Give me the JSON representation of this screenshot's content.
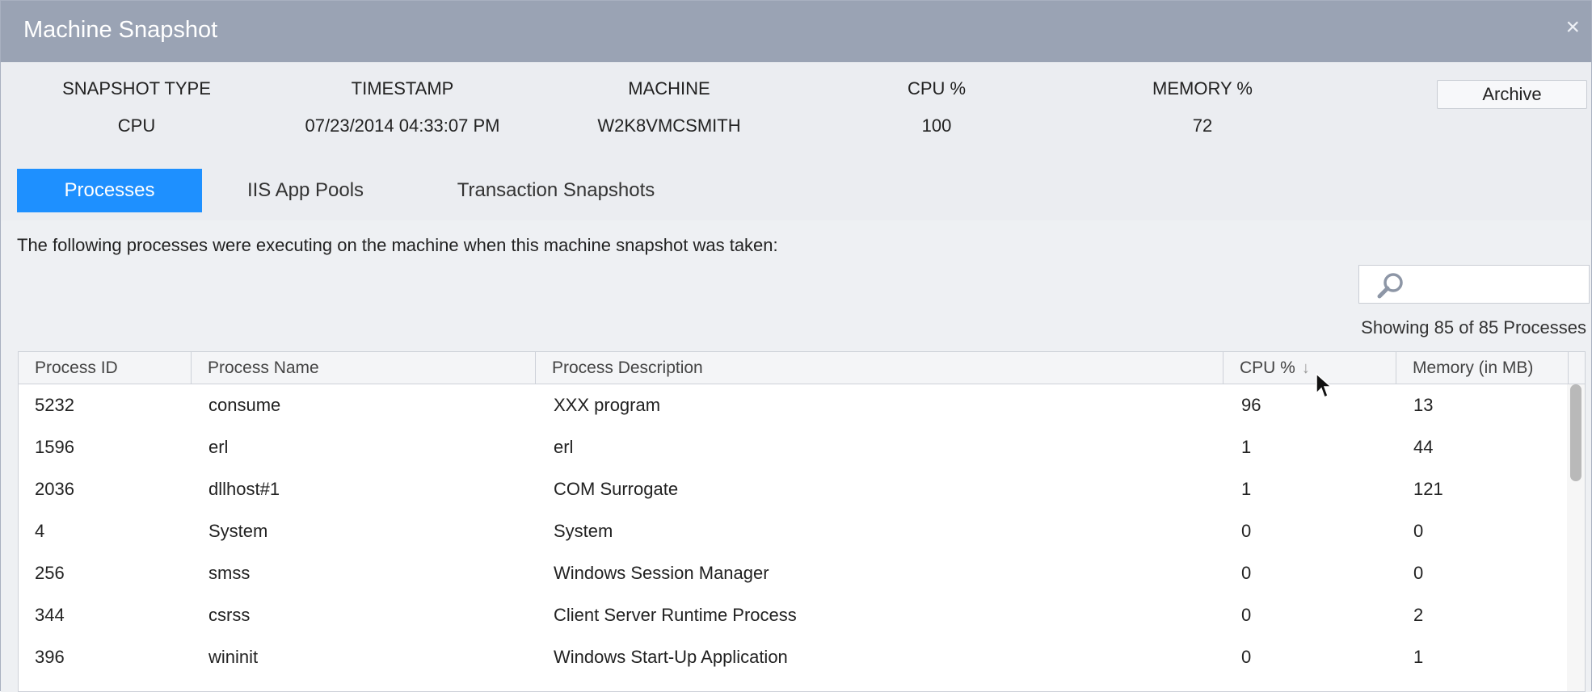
{
  "window": {
    "title": "Machine Snapshot",
    "close_label": "×"
  },
  "summary": {
    "columns": [
      {
        "header": "SNAPSHOT TYPE",
        "value": "CPU"
      },
      {
        "header": "TIMESTAMP",
        "value": "07/23/2014 04:33:07 PM"
      },
      {
        "header": "MACHINE",
        "value": "W2K8VMCSMITH"
      },
      {
        "header": "CPU %",
        "value": "100"
      },
      {
        "header": "MEMORY %",
        "value": "72"
      }
    ],
    "archive_label": "Archive"
  },
  "tabs": [
    {
      "label": "Processes",
      "active": true
    },
    {
      "label": "IIS App Pools",
      "active": false
    },
    {
      "label": "Transaction Snapshots",
      "active": false
    }
  ],
  "content": {
    "description": "The following processes were executing on the machine when this machine snapshot was taken:",
    "search": {
      "placeholder": "",
      "icon": "search-icon"
    },
    "showing": "Showing 85 of 85 Processes"
  },
  "table": {
    "columns": [
      "Process ID",
      "Process Name",
      "Process Description",
      "CPU %",
      "Memory (in MB)"
    ],
    "sorted_column": "CPU %",
    "sort_direction": "descending",
    "rows": [
      [
        "5232",
        "consume",
        "XXX program",
        "96",
        "13"
      ],
      [
        "1596",
        "erl",
        "erl",
        "1",
        "44"
      ],
      [
        "2036",
        "dllhost#1",
        "COM Surrogate",
        "1",
        "121"
      ],
      [
        "4",
        "System",
        "System",
        "0",
        "0"
      ],
      [
        "256",
        "smss",
        "Windows Session Manager",
        "0",
        "0"
      ],
      [
        "344",
        "csrss",
        "Client Server Runtime Process",
        "0",
        "2"
      ],
      [
        "396",
        "wininit",
        "Windows Start-Up Application",
        "0",
        "1"
      ]
    ]
  },
  "colors": {
    "titlebar": "#9aa3b4",
    "active_tab": "#1e90ff",
    "summary_bg": "#ebedf1",
    "content_bg": "#eef0f3"
  }
}
